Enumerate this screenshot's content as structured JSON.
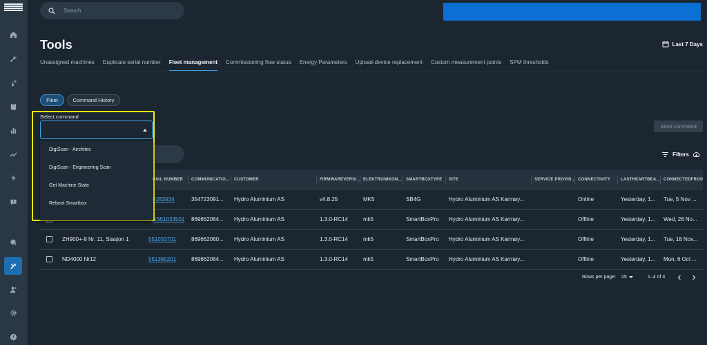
{
  "brand": {
    "logo_text": "Atlas Copco"
  },
  "search": {
    "placeholder": "Search"
  },
  "page": {
    "title": "Tools"
  },
  "date_range": {
    "label": "Last 7 Days"
  },
  "tabs": [
    {
      "label": "Unassigned machines"
    },
    {
      "label": "Duplicate serial number"
    },
    {
      "label": "Fleet management"
    },
    {
      "label": "Commissioning flow status"
    },
    {
      "label": "Energy Parameters"
    },
    {
      "label": "Upload-device replacement"
    },
    {
      "label": "Custom measurement points"
    },
    {
      "label": "SPM thresholds"
    }
  ],
  "toggle": {
    "fleet": "Fleet",
    "history": "Command History"
  },
  "command": {
    "label": "Select command",
    "value": "",
    "options": [
      {
        "label": "DigiScan - Airchitec"
      },
      {
        "label": "DigiScan - Engineering Scan"
      },
      {
        "label": "Get Machine State"
      },
      {
        "label": "Reboot Smartbox"
      }
    ]
  },
  "send_button": "Send command",
  "filters_label": "Filters",
  "table": {
    "columns": [
      {
        "label": ""
      },
      {
        "label": ""
      },
      {
        "label": "RIAL NUMBER"
      },
      {
        "label": "COMMUNICATIO..."
      },
      {
        "label": "CUSTOMER"
      },
      {
        "label": "FIRMWAREVERSI..."
      },
      {
        "label": "ELEKTRONIKON..."
      },
      {
        "label": "SMARTBOXTYPE"
      },
      {
        "label": "SITE"
      },
      {
        "label": "SERVICE PROVID..."
      },
      {
        "label": "CONNECTIVITY"
      },
      {
        "label": "LASTHEARTBEA..."
      },
      {
        "label": "CONNECTEDFROM"
      }
    ],
    "rows": [
      {
        "name": "",
        "serial": "F283934",
        "comm": "354723091...",
        "customer": "Hydro Aluminium AS",
        "firmware": "v4.8.25",
        "elektronikon": "MK5",
        "smartbox": "SB4G",
        "site": "Hydro Aluminium AS Karmøy...",
        "provider": "",
        "connectivity": "Online",
        "heartbeat": "Yesterday, 1...",
        "connected": "Tue, 5 Nov ..."
      },
      {
        "name": "",
        "serial": "SS51033501",
        "comm": "869662064...",
        "customer": "Hydro Aluminium AS",
        "firmware": "1.3.0-RC14",
        "elektronikon": "mk5",
        "smartbox": "SmartBoxPro",
        "site": "Hydro Aluminium AS Karmøy...",
        "provider": "",
        "connectivity": "Offline",
        "heartbeat": "Yesterday, 1...",
        "connected": "Wed, 26 No..."
      },
      {
        "name": "ZH900+-9 Nr. 11, Stasjon 1",
        "serial": "551033701",
        "comm": "869662060...",
        "customer": "Hydro Aluminium AS",
        "firmware": "1.3.0-RC14",
        "elektronikon": "mk5",
        "smartbox": "SmartBoxPro",
        "site": "Hydro Aluminium AS Karmøy...",
        "provider": "",
        "connectivity": "Offline",
        "heartbeat": "Yesterday, 1...",
        "connected": "Tue, 18 Nov..."
      },
      {
        "name": "ND4000 Nr12",
        "serial": "551360201",
        "comm": "869662064...",
        "customer": "Hydro Aluminium AS",
        "firmware": "1.3.0-RC14",
        "elektronikon": "mk5",
        "smartbox": "SmartBoxPro",
        "site": "Hydro Aluminium AS Karmøy...",
        "provider": "",
        "connectivity": "Offline",
        "heartbeat": "Yesterday, 1...",
        "connected": "Mon, 6 Oct ..."
      }
    ]
  },
  "pagination": {
    "rows_per_page_label": "Rows per page:",
    "rows_per_page": "25",
    "range": "1–4 of 4"
  },
  "colors": {
    "accent": "#1f6fb0",
    "highlight": "#f3f00a",
    "banner": "#0b6fd4",
    "link": "#4aa6e6"
  }
}
